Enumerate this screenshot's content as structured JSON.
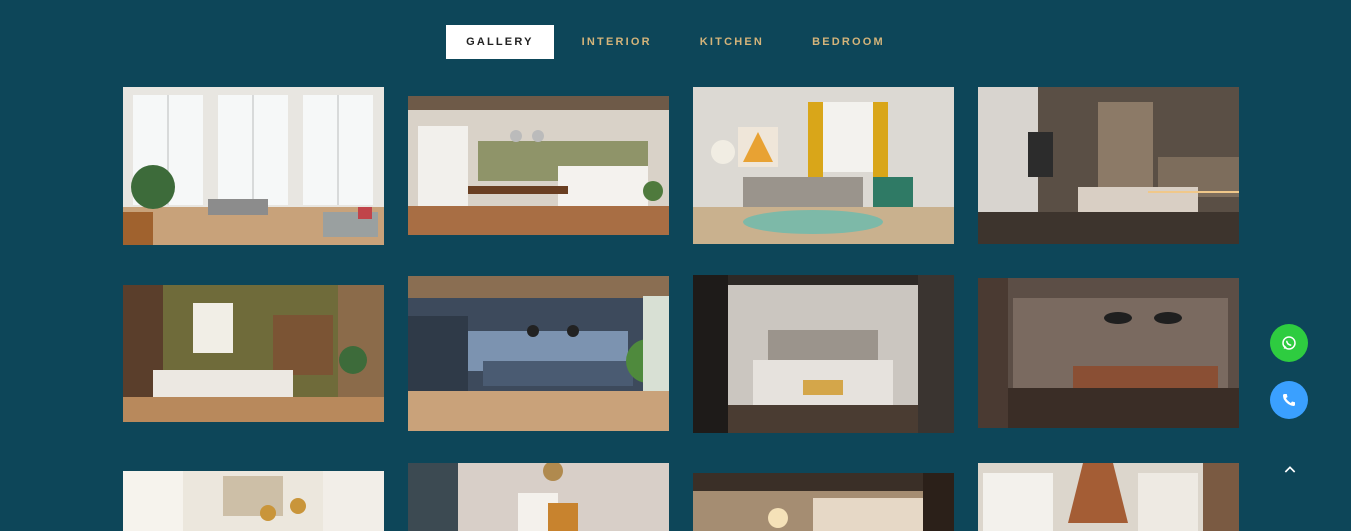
{
  "tabs": [
    {
      "label": "GALLERY",
      "active": true
    },
    {
      "label": "INTERIOR",
      "active": false
    },
    {
      "label": "KITCHEN",
      "active": false
    },
    {
      "label": "BEDROOM",
      "active": false
    }
  ],
  "gallery": {
    "images": [
      {
        "name": "living-room-windows-image"
      },
      {
        "name": "kitchen-dining-image"
      },
      {
        "name": "living-room-yellow-curtains-image"
      },
      {
        "name": "bedroom-dark-image"
      },
      {
        "name": "living-room-olive-wall-image"
      },
      {
        "name": "kitchen-blue-image"
      },
      {
        "name": "bedroom-grey-image"
      },
      {
        "name": "lounge-leather-sofa-image"
      },
      {
        "name": "kitchen-white-cabinets-image"
      },
      {
        "name": "hallway-chandelier-image"
      },
      {
        "name": "bedroom-warm-image"
      },
      {
        "name": "kitchen-range-hood-image"
      }
    ]
  },
  "floating": {
    "whatsapp_icon": "whatsapp-icon",
    "phone_icon": "phone-icon",
    "scroll_top_icon": "chevron-up-icon",
    "colors": {
      "whatsapp": "#2ecc40",
      "phone": "#3aa0ff"
    }
  },
  "colors": {
    "background": "#0d4659",
    "tab_text": "#d4b47a",
    "tab_active_bg": "#ffffff"
  }
}
